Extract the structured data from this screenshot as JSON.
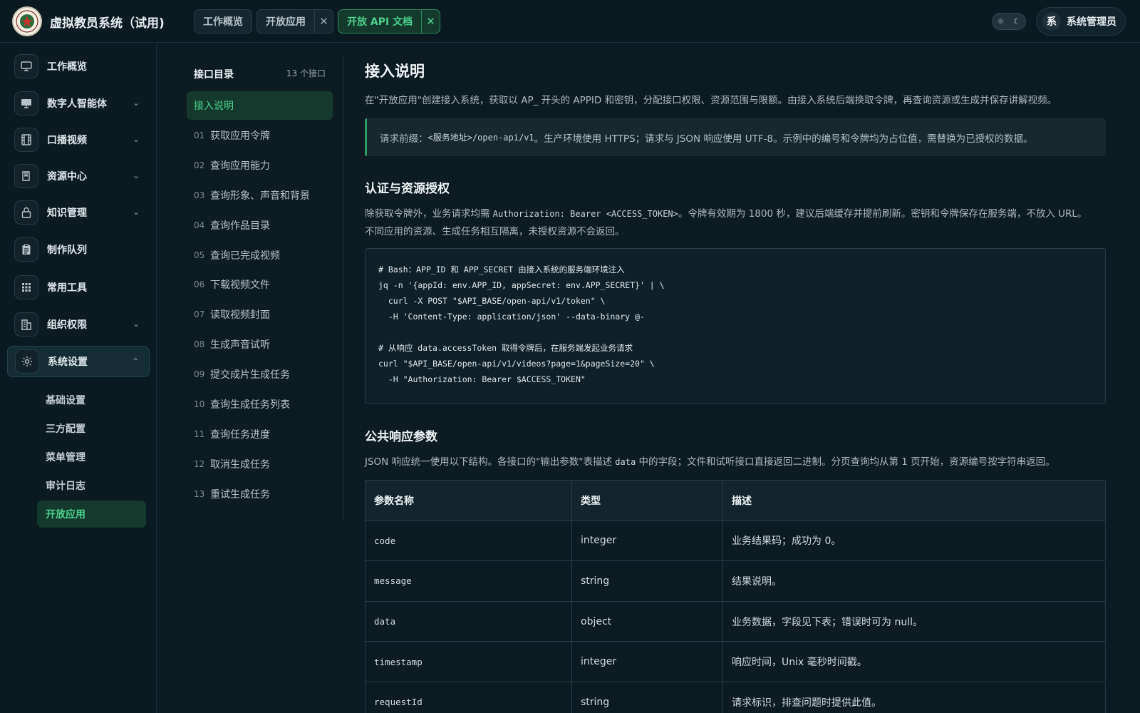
{
  "app": {
    "title": "虚拟教员系统（试用)"
  },
  "tabs": [
    {
      "label": "工作概览",
      "closable": false,
      "active": false
    },
    {
      "label": "开放应用",
      "closable": true,
      "active": false
    },
    {
      "label": "开放 API 文档",
      "closable": true,
      "active": true
    }
  ],
  "theme": {
    "light_icon": "sun-icon",
    "dark_icon": "moon-icon"
  },
  "user": {
    "avatar": "系",
    "name": "系统管理员"
  },
  "sidebar": {
    "items": [
      {
        "label": "工作概览",
        "icon": "monitor-icon",
        "expandable": false
      },
      {
        "label": "数字人智能体",
        "icon": "screen-icon",
        "expandable": true
      },
      {
        "label": "口播视频",
        "icon": "film-icon",
        "expandable": true
      },
      {
        "label": "资源中心",
        "icon": "book-icon",
        "expandable": true
      },
      {
        "label": "知识管理",
        "icon": "lock-icon",
        "expandable": true
      },
      {
        "label": "制作队列",
        "icon": "clipboard-icon",
        "expandable": false
      },
      {
        "label": "常用工具",
        "icon": "grid-icon",
        "expandable": false
      },
      {
        "label": "组织权限",
        "icon": "building-icon",
        "expandable": true
      },
      {
        "label": "系统设置",
        "icon": "gear-icon",
        "expandable": true,
        "open": true
      }
    ],
    "sub_items": [
      {
        "label": "基础设置",
        "active": false
      },
      {
        "label": "三方配置",
        "active": false
      },
      {
        "label": "菜单管理",
        "active": false
      },
      {
        "label": "审计日志",
        "active": false
      },
      {
        "label": "开放应用",
        "active": true
      }
    ]
  },
  "directory": {
    "title": "接口目录",
    "count": "13 个接口",
    "items": [
      {
        "num": "",
        "label": "接入说明",
        "active": true
      },
      {
        "num": "01",
        "label": "获取应用令牌"
      },
      {
        "num": "02",
        "label": "查询应用能力"
      },
      {
        "num": "03",
        "label": "查询形象、声音和背景"
      },
      {
        "num": "04",
        "label": "查询作品目录"
      },
      {
        "num": "05",
        "label": "查询已完成视频"
      },
      {
        "num": "06",
        "label": "下载视频文件"
      },
      {
        "num": "07",
        "label": "读取视频封面"
      },
      {
        "num": "08",
        "label": "生成声音试听"
      },
      {
        "num": "09",
        "label": "提交成片生成任务"
      },
      {
        "num": "10",
        "label": "查询生成任务列表"
      },
      {
        "num": "11",
        "label": "查询任务进度"
      },
      {
        "num": "12",
        "label": "取消生成任务"
      },
      {
        "num": "13",
        "label": "重试生成任务"
      }
    ]
  },
  "content": {
    "heading": "接入说明",
    "intro": "在\"开放应用\"创建接入系统，获取以 AP_ 开头的 APPID 和密钥，分配接口权限、资源范围与限额。由接入系统后端换取令牌，再查询资源或生成并保存讲解视频。",
    "callout": {
      "prefix": "请求前缀：",
      "path": "<服务地址>/open-api/v1",
      "text": "。生产环境使用 HTTPS；请求与 JSON 响应使用 UTF-8。示例中的编号和令牌均为占位值，需替换为已授权的数据。"
    },
    "auth_heading": "认证与资源授权",
    "auth_text_1": "除获取令牌外，业务请求均需 ",
    "auth_header": "Authorization: Bearer <ACCESS_TOKEN>",
    "auth_text_2": "。令牌有效期为 1800 秒，建议后端缓存并提前刷新。密钥和令牌保存在服务端，不放入 URL。",
    "auth_text_3": "不同应用的资源、生成任务相互隔离，未授权资源不会返回。",
    "code_lines": [
      "# Bash：APP_ID 和 APP_SECRET 由接入系统的服务端环境注入",
      "jq -n '{appId: env.APP_ID, appSecret: env.APP_SECRET}' | \\",
      "  curl -X POST \"$API_BASE/open-api/v1/token\" \\",
      "  -H 'Content-Type: application/json' --data-binary @-",
      "",
      "# 从响应 data.accessToken 取得令牌后，在服务端发起业务请求",
      "curl \"$API_BASE/open-api/v1/videos?page=1&pageSize=20\" \\",
      "  -H \"Authorization: Bearer $ACCESS_TOKEN\""
    ],
    "resp_heading": "公共响应参数",
    "resp_text_1": "JSON 响应统一使用以下结构。各接口的\"输出参数\"表描述 ",
    "resp_code": "data",
    "resp_text_2": " 中的字段；文件和试听接口直接返回二进制。分页查询均从第 1 页开始，资源编号按字符串返回。",
    "table": {
      "headers": [
        "参数名称",
        "类型",
        "描述"
      ],
      "rows": [
        [
          "code",
          "integer",
          "业务结果码；成功为 0。"
        ],
        [
          "message",
          "string",
          "结果说明。"
        ],
        [
          "data",
          "object",
          "业务数据，字段见下表；错误时可为 null。"
        ],
        [
          "timestamp",
          "integer",
          "响应时间，Unix 毫秒时间戳。"
        ],
        [
          "requestId",
          "string",
          "请求标识，排查问题时提供此值。"
        ]
      ]
    }
  },
  "colors": {
    "accent": "#4ed08e",
    "background": "#0d1b22",
    "panel": "#17282f"
  }
}
